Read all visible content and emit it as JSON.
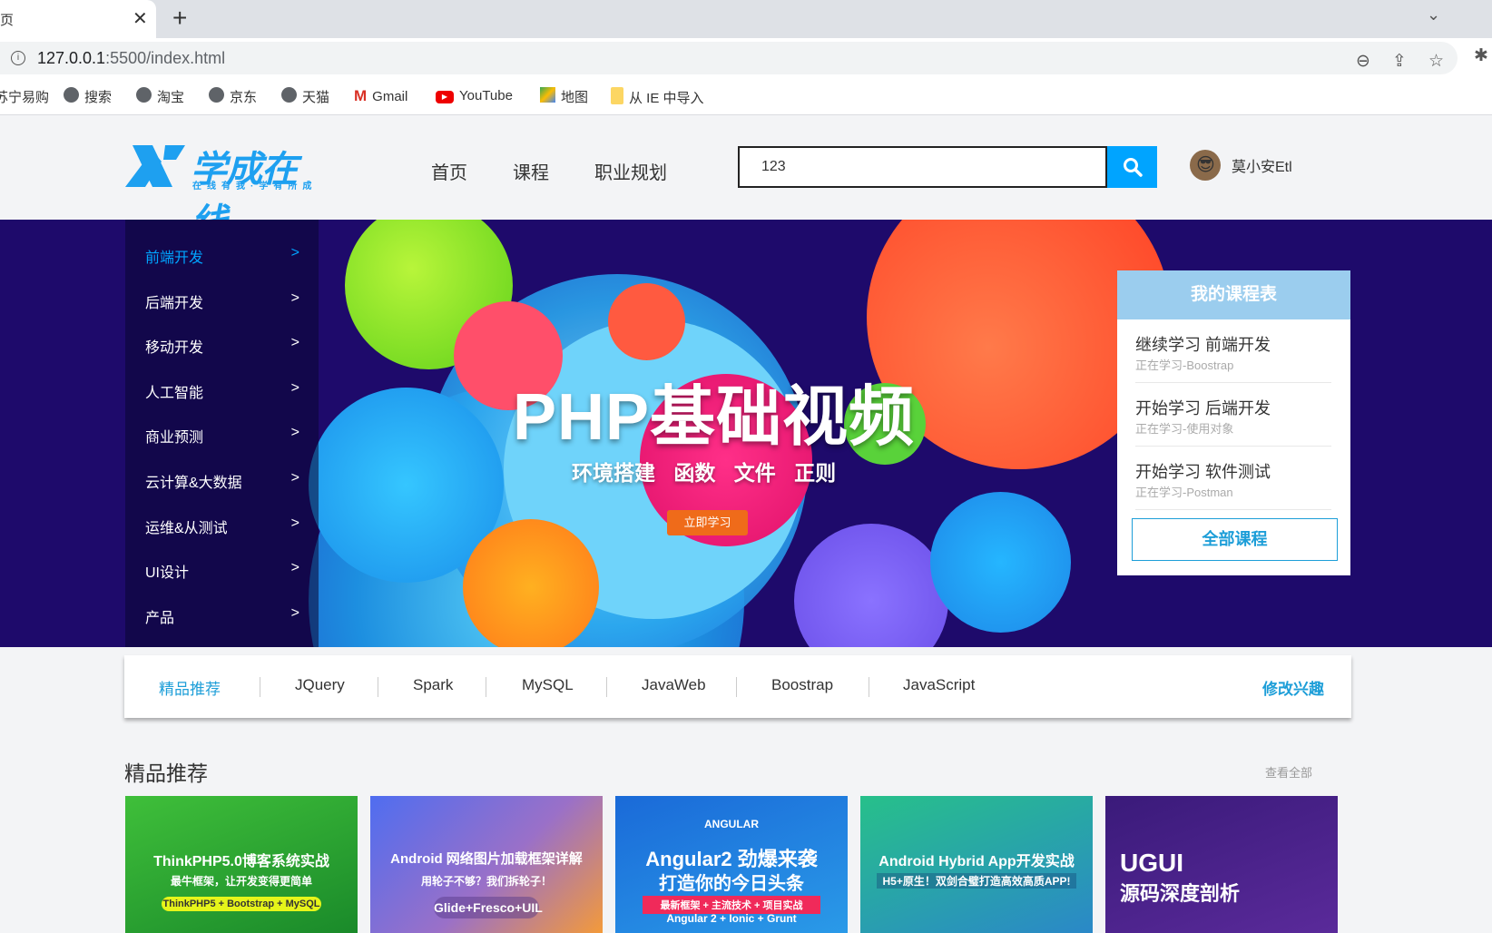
{
  "browser": {
    "tab_title": "页",
    "url_host": "127.0.0.1",
    "url_rest": ":5500/index.html",
    "bookmarks": [
      {
        "label": "苏宁易购",
        "icon": "globe-icon"
      },
      {
        "label": "搜索",
        "icon": "globe-icon"
      },
      {
        "label": "淘宝",
        "icon": "globe-icon"
      },
      {
        "label": "京东",
        "icon": "globe-icon"
      },
      {
        "label": "天猫",
        "icon": "globe-icon"
      },
      {
        "label": "Gmail",
        "icon": "gmail-icon"
      },
      {
        "label": "YouTube",
        "icon": "youtube-icon"
      },
      {
        "label": "地图",
        "icon": "maps-icon"
      },
      {
        "label": "从 IE 中导入",
        "icon": "folder-icon"
      }
    ]
  },
  "header": {
    "logo_text": "学成在线",
    "logo_sub": "在线有我·学有所成",
    "nav": [
      "首页",
      "课程",
      "职业规划"
    ],
    "search_value": "123",
    "user_name": "莫小安Etl"
  },
  "colors": {
    "accent": "#00a4ff",
    "banner_bg": "#1e0a6b",
    "panel_header": "#9bcdee",
    "link": "#1d9ed8"
  },
  "sidebar": {
    "items": [
      {
        "label": "前端开发",
        "active": true
      },
      {
        "label": "后端开发"
      },
      {
        "label": "移动开发"
      },
      {
        "label": "人工智能"
      },
      {
        "label": "商业预测"
      },
      {
        "label": "云计算&大数据"
      },
      {
        "label": "运维&从测试"
      },
      {
        "label": "UI设计"
      },
      {
        "label": "产品"
      }
    ],
    "arrow": ">"
  },
  "banner": {
    "title": "PHP基础视频",
    "subtitle": "环境搭建 函数 文件 正则",
    "cta": "立即学习"
  },
  "schedule": {
    "title": "我的课程表",
    "items": [
      {
        "title": "继续学习 前端开发",
        "sub": "正在学习-Boostrap"
      },
      {
        "title": "开始学习 后端开发",
        "sub": "正在学习-使用对象"
      },
      {
        "title": "开始学习 软件测试",
        "sub": "正在学习-Postman"
      }
    ],
    "all_button": "全部课程"
  },
  "tabs": {
    "items": [
      "精品推荐",
      "JQuery",
      "Spark",
      "MySQL",
      "JavaWeb",
      "Boostrap",
      "JavaScript"
    ],
    "modify": "修改兴趣"
  },
  "section": {
    "title": "精品推荐",
    "view_all": "查看全部",
    "cards": [
      {
        "line1": "ThinkPHP5.0博客系统实战",
        "line2": "最牛框架，让开发变得更简单",
        "line3": "ThinkPHP5 + Bootstrap + MySQL"
      },
      {
        "line1": "Android 网络图片加载框架详解",
        "line2": "用轮子不够？我们拆轮子！",
        "line3": "Glide+Fresco+UIL"
      },
      {
        "line0": "ANGULAR",
        "line1": "Angular2 劲爆来袭",
        "line2": "打造你的今日头条",
        "line3": "最新框架 + 主流技术 + 项目实战",
        "line4": "Angular 2 + Ionic + Grunt"
      },
      {
        "line1": "Android Hybrid App开发实战",
        "line2": "H5+原生！双剑合璧打造高效高质APP!"
      },
      {
        "line1": "UGUI",
        "line2": "源码深度剖析"
      }
    ]
  }
}
